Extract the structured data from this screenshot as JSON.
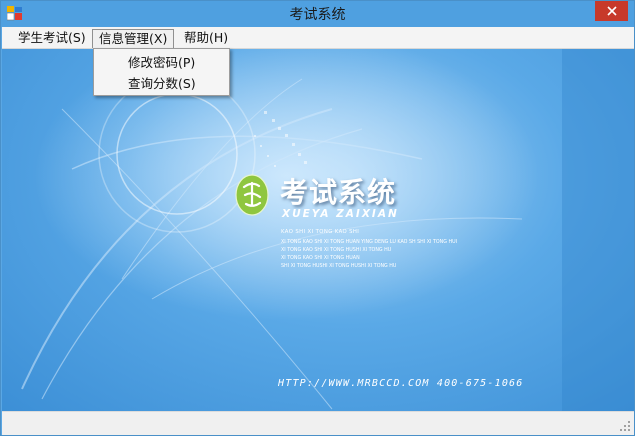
{
  "window": {
    "title": "考试系统"
  },
  "icons": {
    "app": "app-window-icon",
    "close": "close-icon",
    "seal": "seal-logo-icon",
    "grip": "resize-grip-icon"
  },
  "menu": {
    "items": [
      {
        "label": "学生考试(S)"
      },
      {
        "label": "信息管理(X)"
      },
      {
        "label": "帮助(H)"
      }
    ],
    "open_index": 1,
    "dropdown": [
      {
        "label": "修改密码(P)"
      },
      {
        "label": "查询分数(S)"
      }
    ]
  },
  "splash": {
    "brand_cn": "考试系统",
    "brand_en": "XUEYA ZAIXIAN",
    "pinyin_main": "KAO SHI XI TONG KAO SHI",
    "pinyin_lines": [
      "XI TONG KAO SHI XI TONG HUAN YING DENG LU KAO SH SHI XI TONG HUI",
      "XI TONG KAO SHI XI TONG HUSHI XI TONG HU",
      "XI TONG KAO SHI XI TONG HUAN",
      "SHI XI TONG HUSHI XI TONG HUSHI XI TONG HU"
    ],
    "url": "HTTP://WWW.MRBCCD.COM 400-675-1066"
  },
  "colors": {
    "titlebar": "#4fa0e0",
    "close": "#c7392a",
    "menubar": "#f4f4f4",
    "seal": "#8fc63f"
  }
}
